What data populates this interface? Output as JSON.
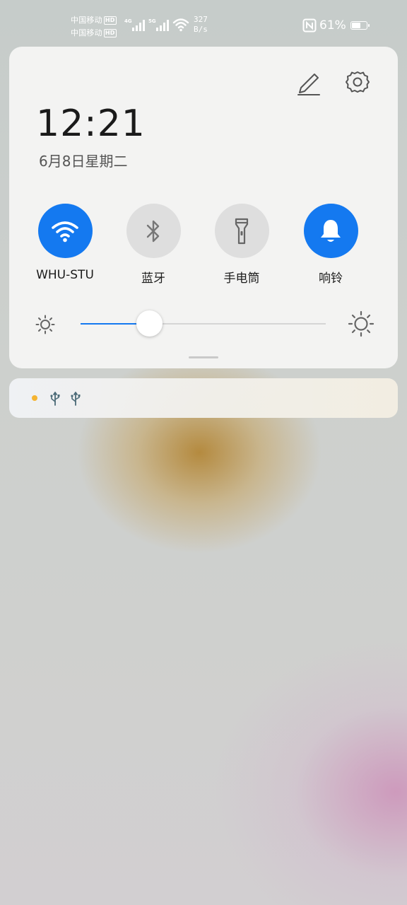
{
  "status_bar": {
    "carriers": [
      {
        "name": "中国移动",
        "badge": "HD"
      },
      {
        "name": "中国移动",
        "badge": "HD"
      }
    ],
    "network_types": [
      "4G",
      "5G"
    ],
    "speed_value": "327",
    "speed_unit": "B/s",
    "battery_percent_text": "61%",
    "battery_level": 0.61,
    "icons": [
      "wifi-icon",
      "nfc-icon",
      "battery-icon"
    ]
  },
  "panel": {
    "time": "12:21",
    "date": "6月8日星期二",
    "toggles": [
      {
        "label": "WHU-STU",
        "icon": "wifi-icon",
        "active": true
      },
      {
        "label": "蓝牙",
        "icon": "bluetooth-icon",
        "active": false
      },
      {
        "label": "手电筒",
        "icon": "flashlight-icon",
        "active": false
      },
      {
        "label": "响铃",
        "icon": "bell-icon",
        "active": true
      }
    ],
    "brightness_level": 0.28
  },
  "notifications": {
    "icons": [
      "notification-dot-icon",
      "usb-icon",
      "usb-icon"
    ],
    "dot_color": "#f5b431"
  },
  "colors": {
    "accent": "#1479f0",
    "toggle_off": "#dedede"
  }
}
